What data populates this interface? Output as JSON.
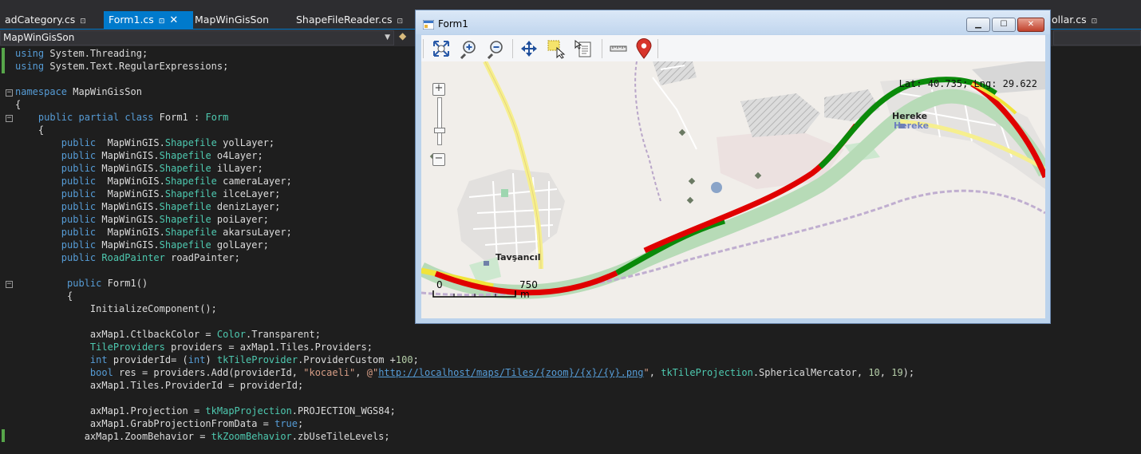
{
  "tabs": [
    {
      "label": "adCategory.cs",
      "pin": "⊡"
    },
    {
      "label": "Form1.cs",
      "pin": "⊡",
      "active": true,
      "close": "✕"
    },
    {
      "label": "MapWinGisSon"
    },
    {
      "label": "ShapeFileReader.cs",
      "pin": "⊡"
    },
    {
      "label": "ollar.cs",
      "pin": "⊡"
    }
  ],
  "navbar": {
    "project": "MapWinGisSon"
  },
  "code_lines": [
    "using System.Threading;",
    "using System.Text.RegularExpressions;",
    "",
    "namespace MapWinGisSon",
    "{",
    "    public partial class Form1 : Form",
    "    {",
    "        public  MapWinGIS.Shapefile yolLayer;",
    "        public MapWinGIS.Shapefile o4Layer;",
    "        public MapWinGIS.Shapefile ilLayer;",
    "        public  MapWinGIS.Shapefile cameraLayer;",
    "        public  MapWinGIS.Shapefile ilceLayer;",
    "        public MapWinGIS.Shapefile denizLayer;",
    "        public MapWinGIS.Shapefile poiLayer;",
    "        public  MapWinGIS.Shapefile akarsuLayer;",
    "        public MapWinGIS.Shapefile golLayer;",
    "        public RoadPainter roadPainter;",
    "",
    "         public Form1()",
    "         {",
    "             InitializeComponent();",
    "",
    "             axMap1.CtlbackColor = Color.Transparent;",
    "             TileProviders providers = axMap1.Tiles.Providers;",
    "             int providerId= (int) tkTileProvider.ProviderCustom +100;",
    "             bool res = providers.Add(providerId, \"kocaeli\", @\"http://localhost/maps/Tiles/{zoom}/{x}/{y}.png\", tkTileProjection.SphericalMercator, 10, 19);",
    "             axMap1.Tiles.ProviderId = providerId;",
    "",
    "             axMap1.Projection = tkMapProjection.PROJECTION_WGS84;",
    "             axMap1.GrabProjectionFromData = true;",
    "            axMap1.ZoomBehavior = tkZoomBehavior.zbUseTileLevels;"
  ],
  "form": {
    "title": "Form1",
    "coord_text": "Lat: 40.735; Lng: 29.622",
    "places": {
      "town": "Tavşancıl",
      "village": "Hereke",
      "village_alt": "Hereke"
    },
    "scale": {
      "start": "0",
      "end": "750",
      "unit": "m"
    },
    "toolbar_icons": [
      "zoom-extent-icon",
      "zoom-in-icon",
      "zoom-out-icon",
      "pan-icon",
      "select-icon",
      "identify-icon",
      "measure-icon",
      "map-pin-icon"
    ],
    "colors": {
      "road_red": "#e00000",
      "road_green": "#0a8a0a",
      "road_yellow": "#f1e43a"
    }
  }
}
